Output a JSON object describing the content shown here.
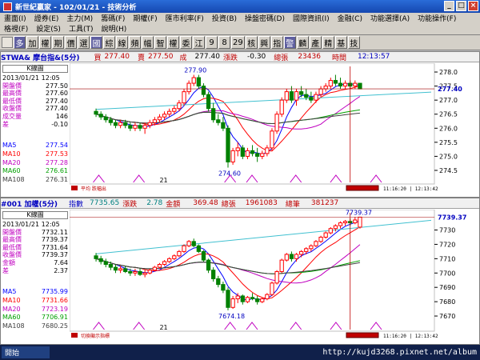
{
  "window": {
    "title": "新世紀贏家 - 102/01/21 - 技術分析"
  },
  "menu": {
    "row1": [
      "畫面(I)",
      "證券(E)",
      "主力(M)",
      "籌碼(F)",
      "期權(F)",
      "匯市利率(F)",
      "投資(B)",
      "操盤密碼(D)",
      "國際資訊(I)",
      "金融(C)",
      "功能選擇(A)",
      "功能操作(F)"
    ],
    "row2": [
      "格視(F)",
      "設定(S)",
      "工具(T)",
      "說明(H)"
    ]
  },
  "toolbar": [
    "多",
    "加",
    "權",
    "期",
    "價",
    "選",
    "國",
    "綜",
    "線",
    "頻",
    "幅",
    "智",
    "權",
    "委",
    "江",
    "9",
    "8",
    "29",
    "核",
    "興",
    "指",
    "警",
    "麟",
    "產",
    "精",
    "基",
    "技"
  ],
  "panel1": {
    "header": {
      "symbol": "STWA& 摩台指&(5分)",
      "buy_label": "買",
      "buy": "277.40",
      "sell_label": "賣",
      "sell": "277.50",
      "deal_label": "成",
      "deal": "277.40",
      "chg_label": "漲跌",
      "chg": "-0.30",
      "vol_label": "總張",
      "vol": "23436",
      "time_label": "時間",
      "time": "12:13:57"
    },
    "kline_label": "K線圖",
    "date": "2013/01/21 12:05",
    "info": [
      {
        "label": "開盤價",
        "value": "277.50"
      },
      {
        "label": "最高價",
        "value": "277.60"
      },
      {
        "label": "最低價",
        "value": "277.40"
      },
      {
        "label": "收盤價",
        "value": "277.40"
      },
      {
        "label": "成交量",
        "value": "146"
      },
      {
        "label": "差",
        "value": "-0.10"
      }
    ],
    "ma": [
      {
        "label": "MA5",
        "value": "277.54",
        "color": "#0000ff"
      },
      {
        "label": "MA10",
        "value": "277.53",
        "color": "#ff0000"
      },
      {
        "label": "MA20",
        "value": "277.28",
        "color": "#c000c0"
      },
      {
        "label": "MA60",
        "value": "276.61",
        "color": "#00a000"
      },
      {
        "label": "MA108",
        "value": "276.31",
        "color": "#404040"
      }
    ],
    "yticks": [
      "278.0",
      "277.5",
      "277.0",
      "276.5",
      "276.0",
      "275.5",
      "275.0",
      "274.5"
    ],
    "ylim": [
      274.3,
      278.2
    ],
    "current_price_label": "277.40",
    "high_annot": "277.90",
    "low_annot": "274.60",
    "day_label": "21",
    "legend_bar": "平均 跌幅出",
    "footer_time": "11:16:20 | 12:13:42"
  },
  "panel2": {
    "header": {
      "symbol": "#001 加權(5分)",
      "idx_label": "指數",
      "idx": "7735.65",
      "chg_label": "漲跌",
      "chg": "2.78",
      "amt_label": "金額",
      "amt": "369.48",
      "vol_label": "總張",
      "vol": "1961083",
      "cnt_label": "總筆",
      "cnt": "381237"
    },
    "kline_label": "K線圖",
    "date": "2013/01/21 12:05",
    "info": [
      {
        "label": "開盤價",
        "value": "7732.11"
      },
      {
        "label": "最高價",
        "value": "7739.37"
      },
      {
        "label": "最低價",
        "value": "7731.64"
      },
      {
        "label": "收盤價",
        "value": "7739.37"
      },
      {
        "label": "金額",
        "value": "7.64"
      },
      {
        "label": "差",
        "value": "2.37"
      }
    ],
    "ma": [
      {
        "label": "MA5",
        "value": "7735.99",
        "color": "#0000ff"
      },
      {
        "label": "MA10",
        "value": "7731.66",
        "color": "#ff0000"
      },
      {
        "label": "MA20",
        "value": "7723.19",
        "color": "#c000c0"
      },
      {
        "label": "MA60",
        "value": "7706.91",
        "color": "#00a000"
      },
      {
        "label": "MA108",
        "value": "7680.25",
        "color": "#404040"
      }
    ],
    "yticks": [
      "7730",
      "7720",
      "7710",
      "7700",
      "7690",
      "7680",
      "7670"
    ],
    "ylim": [
      7665,
      7742
    ],
    "current_price_label": "7739.37",
    "high_annot": "7739.37",
    "low_annot": "7674.18",
    "day_label": "21",
    "legend_bar": "切換顯示指標",
    "footer_time": "11:16:20 | 12:13:42"
  },
  "statusbar": {
    "start": "開始",
    "url": "http://kujd3268.pixnet.net/album"
  },
  "colors": {
    "up": "#ff0000",
    "down": "#008000",
    "ma5": "#0000ff",
    "ma10": "#ff0000",
    "ma20": "#c000c0",
    "ma60": "#00a000",
    "ma108": "#404040",
    "cyan": "#40c0d0"
  },
  "chart_data": [
    {
      "type": "candlestick",
      "title": "STWA& 摩台指&(5分)",
      "ylim": [
        274.3,
        278.2
      ],
      "candles": [
        [
          276.6,
          276.7,
          276.4,
          276.5
        ],
        [
          276.5,
          276.6,
          276.3,
          276.4
        ],
        [
          276.4,
          276.5,
          276.2,
          276.3
        ],
        [
          276.3,
          276.4,
          276.1,
          276.2
        ],
        [
          276.2,
          276.3,
          276.0,
          276.1
        ],
        [
          276.1,
          276.3,
          276.0,
          276.2
        ],
        [
          276.2,
          276.3,
          276.0,
          276.1
        ],
        [
          276.1,
          276.2,
          275.9,
          276.0
        ],
        [
          276.0,
          276.2,
          275.9,
          276.1
        ],
        [
          276.1,
          276.2,
          275.9,
          276.0
        ],
        [
          276.0,
          276.2,
          275.8,
          276.1
        ],
        [
          276.1,
          276.3,
          276.0,
          276.2
        ],
        [
          276.2,
          276.4,
          276.1,
          276.3
        ],
        [
          276.3,
          276.5,
          276.2,
          276.4
        ],
        [
          276.4,
          276.6,
          276.3,
          276.5
        ],
        [
          276.5,
          276.7,
          276.4,
          276.6
        ],
        [
          276.6,
          276.8,
          276.5,
          276.7
        ],
        [
          276.7,
          277.0,
          276.6,
          276.9
        ],
        [
          276.9,
          277.4,
          276.8,
          277.3
        ],
        [
          277.3,
          277.7,
          277.2,
          277.6
        ],
        [
          277.6,
          277.9,
          277.5,
          277.8
        ],
        [
          277.8,
          277.9,
          277.4,
          277.5
        ],
        [
          277.5,
          277.6,
          277.1,
          277.2
        ],
        [
          277.2,
          277.3,
          276.6,
          276.7
        ],
        [
          276.7,
          276.9,
          276.2,
          276.3
        ],
        [
          276.3,
          276.5,
          276.1,
          276.2
        ],
        [
          276.2,
          276.4,
          275.9,
          276.0
        ],
        [
          276.0,
          276.1,
          274.6,
          274.8
        ],
        [
          274.8,
          275.3,
          274.7,
          275.2
        ],
        [
          275.2,
          275.5,
          275.0,
          275.3
        ],
        [
          275.3,
          275.4,
          274.9,
          275.0
        ],
        [
          275.0,
          275.3,
          274.9,
          275.2
        ],
        [
          275.2,
          275.4,
          275.0,
          275.1
        ],
        [
          275.1,
          275.3,
          274.8,
          275.0
        ],
        [
          275.0,
          275.2,
          274.9,
          275.1
        ],
        [
          275.1,
          275.4,
          275.0,
          275.3
        ],
        [
          275.3,
          276.0,
          275.2,
          275.9
        ],
        [
          275.9,
          276.6,
          275.8,
          276.5
        ],
        [
          276.5,
          277.1,
          276.4,
          277.0
        ],
        [
          277.0,
          277.4,
          276.9,
          277.3
        ],
        [
          277.3,
          277.5,
          276.9,
          277.0
        ],
        [
          277.0,
          277.4,
          276.8,
          277.3
        ],
        [
          277.3,
          277.5,
          277.1,
          277.2
        ],
        [
          277.2,
          277.4,
          277.0,
          277.1
        ],
        [
          277.1,
          277.3,
          276.9,
          277.0
        ],
        [
          277.0,
          277.3,
          276.9,
          277.2
        ],
        [
          277.2,
          277.5,
          277.1,
          277.4
        ],
        [
          277.4,
          277.6,
          277.3,
          277.5
        ],
        [
          277.5,
          277.8,
          277.4,
          277.7
        ],
        [
          277.7,
          277.9,
          277.5,
          277.6
        ],
        [
          277.6,
          277.8,
          277.4,
          277.5
        ],
        [
          277.5,
          277.7,
          277.4,
          277.6
        ],
        [
          277.6,
          277.7,
          277.4,
          277.5
        ],
        [
          277.5,
          277.7,
          277.4,
          277.6
        ],
        [
          277.6,
          277.6,
          277.4,
          277.4
        ]
      ]
    },
    {
      "type": "candlestick",
      "title": "#001 加權(5分)",
      "ylim": [
        7665,
        7742
      ],
      "candles": [
        [
          7712,
          7714,
          7708,
          7710
        ],
        [
          7710,
          7712,
          7706,
          7708
        ],
        [
          7708,
          7710,
          7704,
          7706
        ],
        [
          7706,
          7708,
          7702,
          7704
        ],
        [
          7704,
          7706,
          7700,
          7702
        ],
        [
          7702,
          7705,
          7700,
          7703
        ],
        [
          7703,
          7705,
          7700,
          7701
        ],
        [
          7701,
          7703,
          7698,
          7700
        ],
        [
          7700,
          7703,
          7698,
          7701
        ],
        [
          7701,
          7703,
          7698,
          7699
        ],
        [
          7699,
          7702,
          7697,
          7700
        ],
        [
          7700,
          7703,
          7699,
          7702
        ],
        [
          7702,
          7705,
          7701,
          7704
        ],
        [
          7704,
          7707,
          7703,
          7706
        ],
        [
          7706,
          7709,
          7705,
          7708
        ],
        [
          7708,
          7711,
          7707,
          7710
        ],
        [
          7710,
          7713,
          7709,
          7712
        ],
        [
          7712,
          7716,
          7711,
          7715
        ],
        [
          7715,
          7720,
          7714,
          7719
        ],
        [
          7719,
          7723,
          7718,
          7722
        ],
        [
          7722,
          7724,
          7718,
          7719
        ],
        [
          7719,
          7720,
          7714,
          7715
        ],
        [
          7715,
          7716,
          7708,
          7709
        ],
        [
          7709,
          7710,
          7700,
          7702
        ],
        [
          7702,
          7704,
          7694,
          7696
        ],
        [
          7696,
          7698,
          7690,
          7692
        ],
        [
          7692,
          7694,
          7686,
          7688
        ],
        [
          7688,
          7690,
          7674,
          7676
        ],
        [
          7676,
          7684,
          7675,
          7682
        ],
        [
          7682,
          7686,
          7679,
          7684
        ],
        [
          7684,
          7685,
          7678,
          7680
        ],
        [
          7680,
          7684,
          7679,
          7683
        ],
        [
          7683,
          7686,
          7681,
          7682
        ],
        [
          7682,
          7684,
          7678,
          7680
        ],
        [
          7680,
          7683,
          7679,
          7682
        ],
        [
          7682,
          7686,
          7681,
          7685
        ],
        [
          7685,
          7694,
          7684,
          7693
        ],
        [
          7693,
          7702,
          7692,
          7701
        ],
        [
          7701,
          7710,
          7700,
          7709
        ],
        [
          7709,
          7714,
          7708,
          7713
        ],
        [
          7713,
          7715,
          7708,
          7710
        ],
        [
          7710,
          7714,
          7708,
          7713
        ],
        [
          7713,
          7716,
          7711,
          7715
        ],
        [
          7715,
          7718,
          7713,
          7717
        ],
        [
          7717,
          7720,
          7715,
          7719
        ],
        [
          7719,
          7723,
          7718,
          7722
        ],
        [
          7722,
          7726,
          7721,
          7725
        ],
        [
          7725,
          7729,
          7724,
          7728
        ],
        [
          7728,
          7732,
          7727,
          7731
        ],
        [
          7731,
          7734,
          7729,
          7733
        ],
        [
          7733,
          7736,
          7731,
          7735
        ],
        [
          7735,
          7737,
          7733,
          7736
        ],
        [
          7736,
          7738,
          7733,
          7735
        ],
        [
          7735,
          7739,
          7734,
          7737
        ],
        [
          7732,
          7739,
          7731,
          7739
        ]
      ]
    }
  ]
}
